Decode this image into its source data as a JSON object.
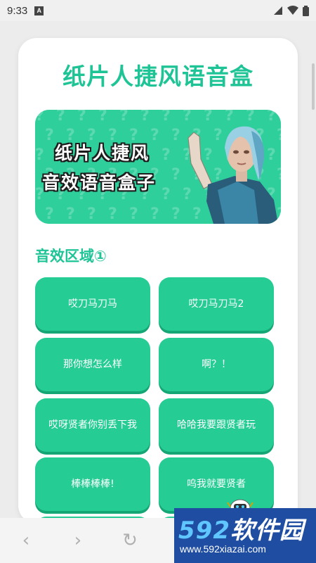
{
  "status_bar": {
    "time": "9:33",
    "notification_letter": "A"
  },
  "app": {
    "title": "纸片人捷风语音盒",
    "banner": {
      "line1": "纸片人捷风",
      "line2": "音效语音盒子"
    },
    "section_title": "音效区域①",
    "sound_buttons": [
      "哎刀马刀马",
      "哎刀马刀马2",
      "那你想怎么样",
      "啊？！",
      "哎呀贤者你别丢下我",
      "哈哈我要跟贤者玩",
      "棒棒棒棒!",
      "呜我就要贤者"
    ]
  },
  "nav": {
    "back_icon": "‹",
    "forward_icon": "›",
    "refresh_icon": "↻"
  },
  "watermark": {
    "brand_num": "592",
    "brand_text": "软件园",
    "url": "www.592xiazai.com"
  },
  "colors": {
    "accent": "#1fc496",
    "button": "#25cc94",
    "button_shadow": "#15a676"
  }
}
